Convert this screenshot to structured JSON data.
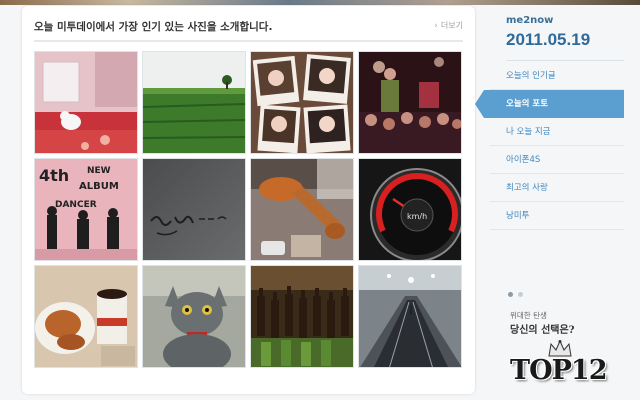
{
  "panel": {
    "title": "오늘 미투데이에서 가장 인기 있는 사진을 소개합니다.",
    "more_label": "더보기"
  },
  "photos": [
    {
      "name": "photo-bedroom",
      "bg": "#e7c0c4",
      "accent": "#c2363e"
    },
    {
      "name": "photo-green-field",
      "bg": "#e6ece6",
      "accent": "#3f7d2c"
    },
    {
      "name": "photo-polaroid-girls",
      "bg": "#5a3a2a",
      "accent": "#f0e8e0"
    },
    {
      "name": "photo-concert-crowd",
      "bg": "#2a1418",
      "accent": "#c23a4a"
    },
    {
      "name": "photo-album-poster",
      "bg": "#e8b0b8",
      "accent": "#222222"
    },
    {
      "name": "photo-handwriting",
      "bg": "#5b5d5f",
      "accent": "#2a2a2a"
    },
    {
      "name": "photo-chicken-leg",
      "bg": "#8a7a70",
      "accent": "#c06a28"
    },
    {
      "name": "photo-speedometer",
      "bg": "#1c1c1c",
      "accent": "#d82020"
    },
    {
      "name": "photo-fried-chicken-cola",
      "bg": "#d8c4a8",
      "accent": "#b0502a"
    },
    {
      "name": "photo-gray-cat",
      "bg": "#9aa098",
      "accent": "#5f6468"
    },
    {
      "name": "photo-bottles",
      "bg": "#3a2a18",
      "accent": "#6a8a3a"
    },
    {
      "name": "photo-moving-walkway",
      "bg": "#7a8288",
      "accent": "#d0d8dc"
    }
  ],
  "sidebar": {
    "brand": "me2now",
    "date": "2011.05.19",
    "items": [
      {
        "label": "오늘의 인기글",
        "active": false
      },
      {
        "label": "오늘의 포토",
        "active": true
      },
      {
        "label": "나 오늘 지금",
        "active": false
      },
      {
        "label": "아이폰4S",
        "active": false
      },
      {
        "label": "최고의 사랑",
        "active": false
      },
      {
        "label": "낭미투",
        "active": false
      }
    ],
    "promo": {
      "small": "위대한 탄생",
      "big": "당신의 선택은?",
      "logo": "TOP12"
    }
  },
  "colors": {
    "accent_blue": "#3f86bd",
    "active_bg": "#5b9fd0",
    "date_blue": "#2f6a9a"
  }
}
